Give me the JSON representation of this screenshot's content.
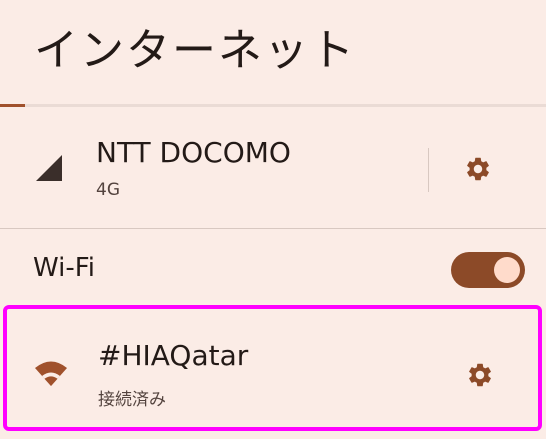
{
  "header": {
    "title": "インターネット",
    "progress_fraction": 0.045
  },
  "mobile_network": {
    "carrier_name": "NTT DOCOMO",
    "network_type": "4G",
    "signal_icon": "signal-strength-icon",
    "settings_icon": "gear-icon"
  },
  "wifi": {
    "label": "Wi-Fi",
    "enabled": true
  },
  "connected_network": {
    "ssid": "#HIAQatar",
    "status": "接続済み",
    "icon": "wifi-icon",
    "settings_icon": "gear-icon"
  },
  "colors": {
    "background": "#fbece6",
    "accent": "#a0512c",
    "toggle_track": "#8c4a28",
    "toggle_knob": "#ffdbcb",
    "highlight": "#ff00ff"
  }
}
